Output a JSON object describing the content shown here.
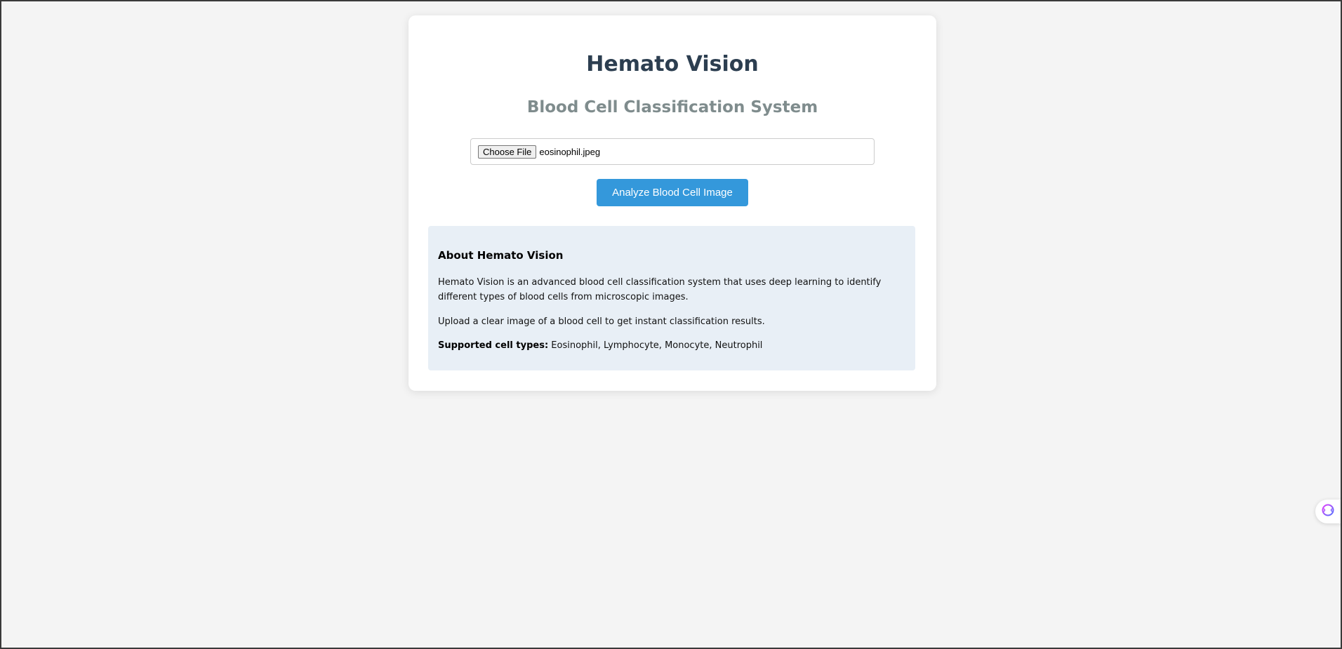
{
  "header": {
    "title": "Hemato Vision",
    "subtitle": "Blood Cell Classification System"
  },
  "upload": {
    "choose_label": "Choose File",
    "file_name": "eosinophil.jpeg",
    "analyze_label": "Analyze Blood Cell Image"
  },
  "about": {
    "heading": "About Hemato Vision",
    "paragraph1": "Hemato Vision is an advanced blood cell classification system that uses deep learning to identify different types of blood cells from microscopic images.",
    "paragraph2": "Upload a clear image of a blood cell to get instant classification results.",
    "supported_label": "Supported cell types:",
    "supported_types": " Eosinophil, Lymphocyte, Monocyte, Neutrophil"
  },
  "widget": {
    "icon": "brain-icon"
  },
  "colors": {
    "accent": "#3498db",
    "title": "#2c3e50",
    "subtitle": "#7f8c8d",
    "about_bg": "#e8eff6",
    "page_bg": "#f4f4f4"
  }
}
